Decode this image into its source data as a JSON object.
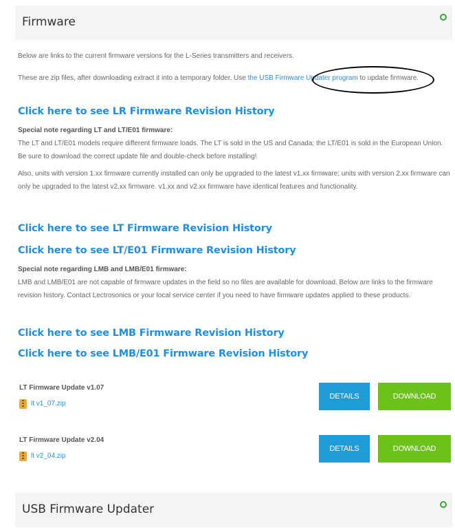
{
  "firmware": {
    "title": "Firmware",
    "intro": "Below are links to the current firmware versions for the L-Series transmitters and receivers.",
    "zip_text_before": "These are zip files, after downloading extract it into a temporary folder. Use ",
    "zip_link": "the USB Firmware Updater program",
    "zip_text_after": " to update firmware.",
    "lr_history_link": "Click here to see LR Firmware Revision History",
    "lt_note_title": "Special note regarding LT and LT/E01 firmware:",
    "lt_note_body": "The LT and LT/E01 models require different firmware loads. The LT is sold in the US and Canada; the LT/E01 is sold in the European Union. Be sure to download the correct update file and double-check before installing!",
    "lt_note_body2": "Also, units with version 1.xx firmware currently installed can only be upgraded to the latest v1.xx firmware; units with version 2.xx firmware can only be upgraded to the latest v2.xx firmware. v1.xx and v2.xx firmware have identical features and functionality.",
    "lt_history_link": "Click here to see LT Firmware Revision History",
    "lte01_history_link": "Click here to see LT/E01 Firmware Revision History",
    "lmb_note_title": "Special note regarding LMB and LMB/E01 firmware:",
    "lmb_note_body": "LMB and LMB/E01 are not capable of firmware updates in the field so no files are available for download. Below are links to the firmware revision history. Contact Lectrosonics or your local service center if you need to have firmware updates applied to these products.",
    "lmb_history_link": "Click here to see LMB Firmware Revision History",
    "lmbe01_history_link": "Click here to see LMB/E01 Firmware Revision History",
    "updates": [
      {
        "name": "LT Firmware Update v1.07",
        "file": "lt v1_07.zip",
        "details": "DETAILS",
        "download": "DOWNLOAD"
      },
      {
        "name": "LT Firmware Update v2.04",
        "file": "lt v2_04.zip",
        "details": "DETAILS",
        "download": "DOWNLOAD"
      }
    ]
  },
  "usb_updater": {
    "title": "USB Firmware Updater"
  },
  "icons": {
    "toggle": "circle-toggle-icon",
    "zip": "zip-file-icon"
  },
  "colors": {
    "link": "#1f8fe0",
    "details_button": "#1f9bd6",
    "download_button": "#6cc21a",
    "toggle": "#3aa43a"
  }
}
